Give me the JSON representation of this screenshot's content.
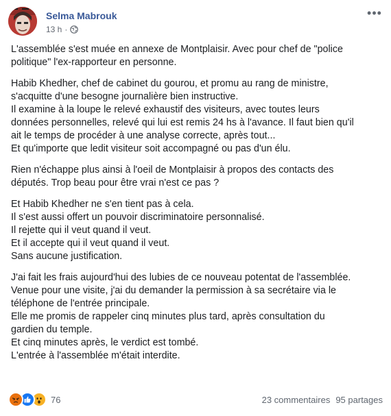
{
  "post": {
    "author": "Selma Mabrouk",
    "time": "13 h",
    "privacy_icon": "globe-icon",
    "more_icon": "more-options-icon",
    "paragraphs": [
      [
        "L'assemblée s'est muée en annexe de Montplaisir. Avec pour chef de \"police",
        "politique\" l'ex-rapporteur en personne."
      ],
      [
        "Habib Khedher, chef de cabinet du gourou, et promu au rang de ministre,",
        "s'acquitte d'une besogne journalière bien instructive.",
        "Il examine à la loupe le relevé exhaustif des visiteurs, avec toutes leurs",
        "données personnelles, relevé qui lui est remis 24 hs à l'avance. Il faut bien qu'il",
        "ait le temps de procéder à une analyse correcte, après tout...",
        "Et qu'importe que ledit visiteur soit accompagné ou pas d'un élu."
      ],
      [
        "Rien n'échappe plus ainsi à l'oeil de Montplaisir à propos des contacts des",
        "députés. Trop beau pour être vrai n'est ce pas ?"
      ],
      [
        "Et Habib Khedher ne s'en tient pas à cela.",
        "Il s'est aussi offert un pouvoir discriminatoire personnalisé.",
        "Il rejette qui il veut quand il veut.",
        "Et il accepte qui il veut quand il veut.",
        "Sans aucune justification."
      ],
      [
        "J'ai fait les frais aujourd'hui des lubies de ce nouveau potentat de l'assemblée.",
        "Venue pour une visite, j'ai du demander la permission à sa secrétaire via le",
        "téléphone de l'entrée principale.",
        "Elle me promis de rappeler cinq minutes plus tard, après consultation du",
        "gardien du temple.",
        "Et cinq minutes après, le verdict est tombé.",
        "L'entrée à l'assemblée m'était interdite."
      ]
    ]
  },
  "reactions": {
    "icons": [
      "angry-reaction-icon",
      "like-reaction-icon",
      "wow-reaction-icon"
    ],
    "count": "76",
    "colors": {
      "angry": "#e9710f",
      "like": "#1877f2",
      "wow": "#f7b125"
    }
  },
  "stats": {
    "comments": "23 commentaires",
    "shares": "95 partages"
  },
  "colors": {
    "author": "#385898",
    "meta": "#616770",
    "text": "#1c1e21"
  }
}
